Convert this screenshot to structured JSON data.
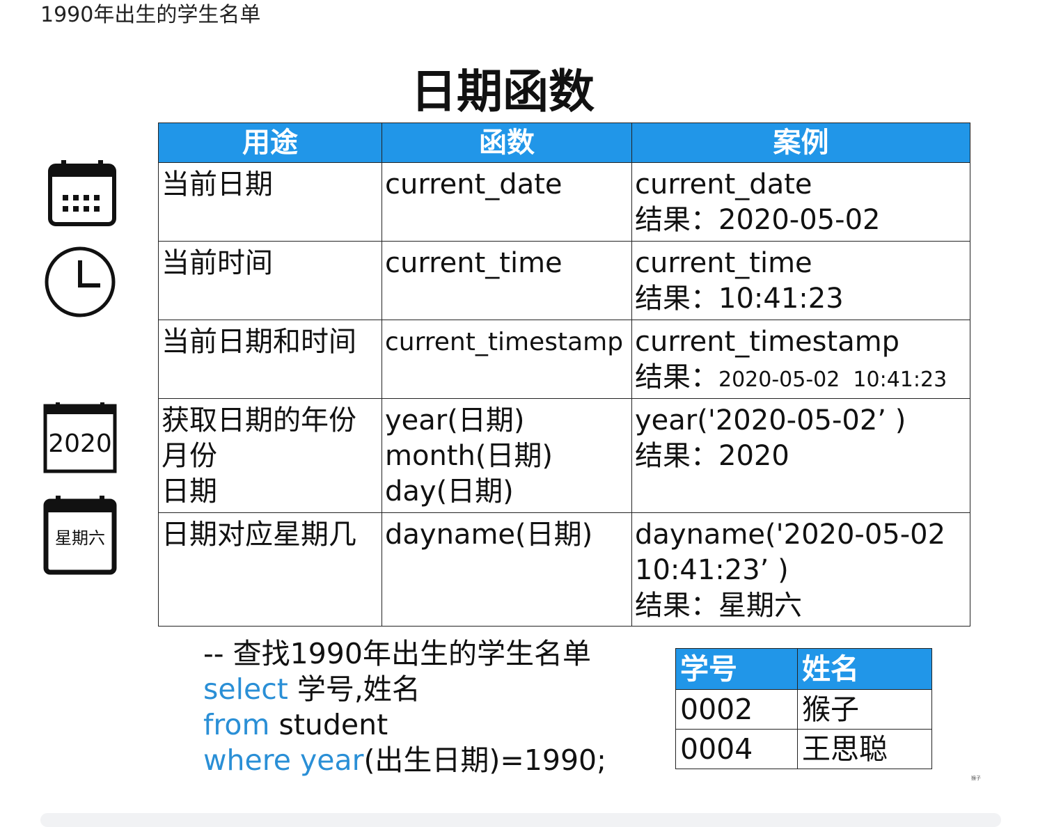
{
  "heading": "1990年出生的学生名单",
  "slide": {
    "title": "日期函数",
    "table": {
      "headers": [
        "用途",
        "函数",
        "案例"
      ],
      "rows": [
        {
          "purpose": "当前日期",
          "function": "current_date",
          "example": "current_date",
          "result_label": "结果：",
          "result": "2020-05-02"
        },
        {
          "purpose": "当前时间",
          "function": "current_time",
          "example": "current_time",
          "result_label": "结果：",
          "result": "10:41:23"
        },
        {
          "purpose": "当前日期和时间",
          "function": "current_timestamp",
          "example": "current_timestamp",
          "result_label": "结果：",
          "result": "2020-05-02  10:41:23"
        },
        {
          "purpose": "获取日期的年份\n月份\n日期",
          "function": "year(日期)\nmonth(日期)\nday(日期)",
          "example": "year('2020-05-02’ )",
          "result_label": "结果：",
          "result": "2020"
        },
        {
          "purpose": "日期对应星期几",
          "function": "dayname(日期)",
          "example": "dayname('2020-05-02\n10:41:23’ )",
          "result_label": "结果：",
          "result": "星期六"
        }
      ]
    },
    "icons": {
      "calendar": "calendar-icon",
      "clock": "clock-icon",
      "year_calendar": {
        "name": "year-calendar-icon",
        "text": "2020"
      },
      "weekday_calendar": {
        "name": "weekday-calendar-icon",
        "text": "星期六"
      }
    },
    "code": {
      "comment": "-- 查找1990年出生的学生名单",
      "line1_kw": "select",
      "line1_rest": " 学号,姓名",
      "line2_kw": "from",
      "line2_rest": " student",
      "line3_kw": "where year",
      "line3_rest": "(出生日期)=1990;"
    },
    "result_table": {
      "headers": [
        "学号",
        "姓名"
      ],
      "rows": [
        [
          "0002",
          "猴子"
        ],
        [
          "0004",
          "王思聪"
        ]
      ]
    },
    "watermark": "猴子"
  },
  "colors": {
    "header_bg": "#2196e8",
    "keyword": "#2a8fd6"
  }
}
